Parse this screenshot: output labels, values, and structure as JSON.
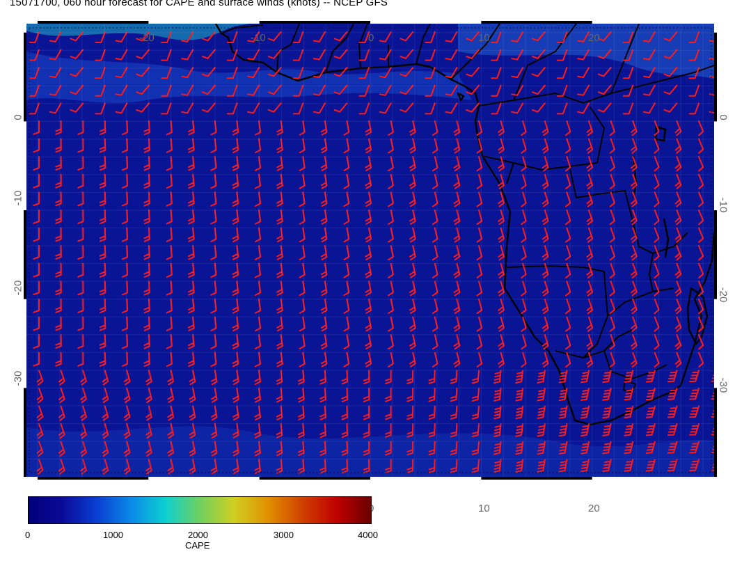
{
  "title": "15071700, 060 hour forecast for CAPE and surface winds (knots) -- NCEP GFS",
  "map": {
    "lon_range": [
      -31,
      31
    ],
    "lat_range": [
      -40,
      11
    ],
    "x_ticks": [
      -20,
      -10,
      0,
      10,
      20
    ],
    "y_ticks": [
      0,
      -10,
      -20,
      -30
    ],
    "coastline_color": "#000000",
    "background_color": "#0a1596",
    "wind_barb_color": "#ff1a1a",
    "grid": true
  },
  "colorbar": {
    "label": "CAPE",
    "ticks": [
      "0",
      "1000",
      "2000",
      "3000",
      "4000"
    ],
    "range": [
      0,
      4000
    ],
    "colors": [
      "#00007a",
      "#0b0b9a",
      "#0a3fd2",
      "#0a8ae8",
      "#0dd0d0",
      "#70d060",
      "#d0d020",
      "#e09000",
      "#d04000",
      "#c00000",
      "#6a0000"
    ]
  }
}
